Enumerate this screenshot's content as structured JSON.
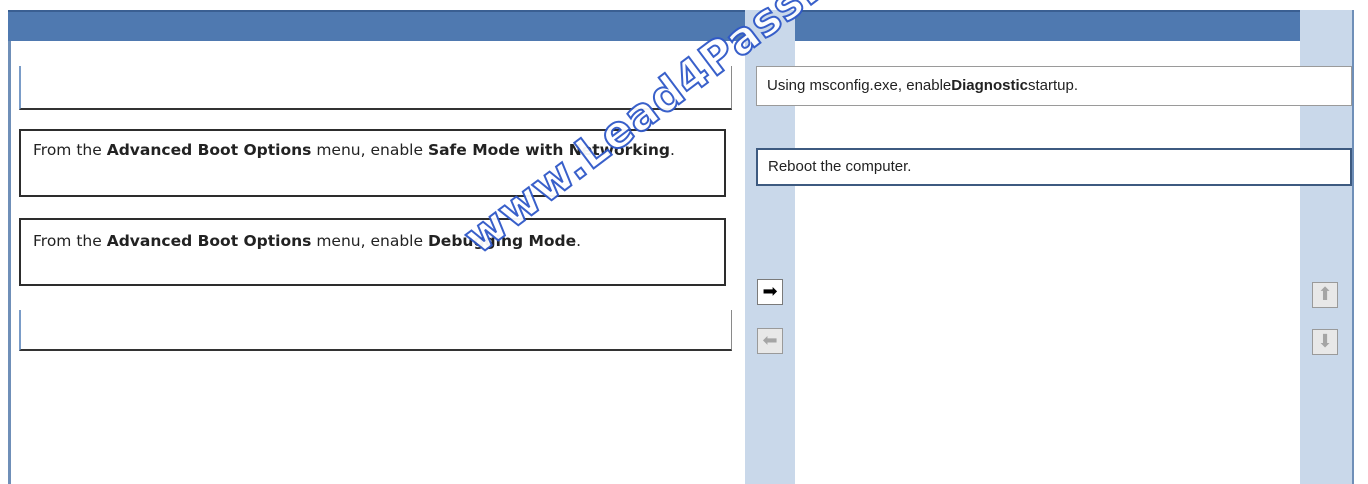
{
  "left_list": {
    "items": [
      {
        "text": ""
      },
      {
        "parts": [
          {
            "t": "From the ",
            "b": false
          },
          {
            "t": "Advanced Boot Options",
            "b": true
          },
          {
            "t": " menu, enable ",
            "b": false
          },
          {
            "t": "Safe Mode with Networking",
            "b": true
          },
          {
            "t": ".",
            "b": false
          }
        ]
      },
      {
        "parts": [
          {
            "t": "From the ",
            "b": false
          },
          {
            "t": "Advanced Boot Options",
            "b": true
          },
          {
            "t": " menu, enable ",
            "b": false
          },
          {
            "t": "Debugging Mode",
            "b": true
          },
          {
            "t": ".",
            "b": false
          }
        ]
      },
      {
        "text": ""
      }
    ]
  },
  "right_list": {
    "items": [
      {
        "parts": [
          {
            "t": "Using msconfig.exe, enable ",
            "b": false
          },
          {
            "t": "Diagnostic",
            "b": true
          },
          {
            "t": " startup.",
            "b": false
          }
        ]
      },
      {
        "text": "Reboot the computer."
      }
    ]
  },
  "controls": {
    "move_right": {
      "icon": "arrow-right-icon",
      "glyph": "➡"
    },
    "move_left": {
      "icon": "arrow-left-icon",
      "glyph": "⬅"
    },
    "move_up": {
      "icon": "arrow-up-icon",
      "glyph": "⬆"
    },
    "move_down": {
      "icon": "arrow-down-icon",
      "glyph": "⬇"
    }
  },
  "watermark": {
    "text": "www.Lead4Pass.com"
  },
  "colors": {
    "header": "#4f79b0",
    "column_bg": "#c9d8ea",
    "watermark_stroke": "#2f58c8"
  }
}
